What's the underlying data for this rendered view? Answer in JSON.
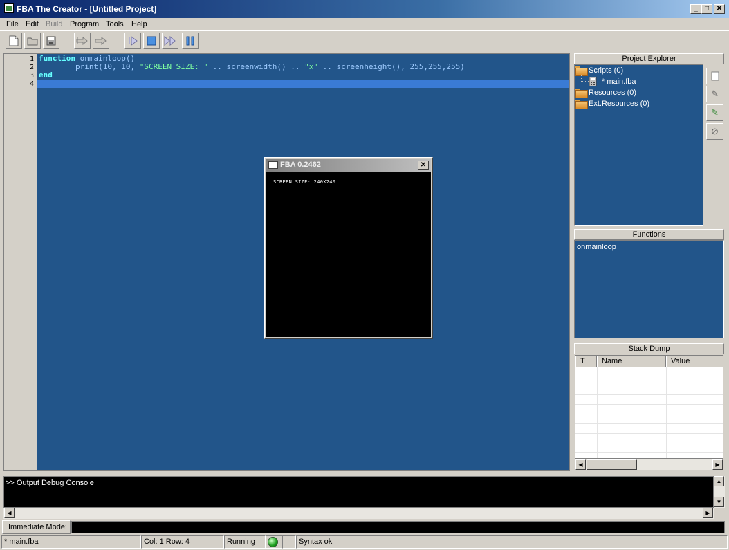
{
  "window": {
    "title": "FBA The Creator - [Untitled Project]",
    "controls": {
      "minimize": "_",
      "maximize": "□",
      "close": "✕"
    }
  },
  "menu": [
    "File",
    "Edit",
    "Build",
    "Program",
    "Tools",
    "Help"
  ],
  "menu_disabled": [
    "Build"
  ],
  "toolbar": {
    "buttons": [
      {
        "name": "new",
        "icon": "new-file-icon"
      },
      {
        "name": "open",
        "icon": "open-folder-icon"
      },
      {
        "name": "save",
        "icon": "save-disk-icon"
      },
      {
        "name": "step-into",
        "icon": "step-into-icon"
      },
      {
        "name": "step-over",
        "icon": "step-over-icon"
      },
      {
        "name": "run",
        "icon": "run-icon"
      },
      {
        "name": "stop",
        "icon": "stop-icon"
      },
      {
        "name": "fast-forward",
        "icon": "fast-forward-icon"
      },
      {
        "name": "pause",
        "icon": "pause-icon"
      }
    ]
  },
  "editor": {
    "line_numbers": [
      "1",
      "2",
      "3",
      "4"
    ],
    "lines": [
      {
        "kw": "function",
        "rest": " onmainloop()"
      },
      {
        "pre": "        print(10, 10, ",
        "str1": "\"SCREEN SIZE: \"",
        "mid": " .. screenwidth() .. ",
        "str2": "\"x\"",
        "post": " .. screenheight(), 255,255,255)"
      },
      {
        "kw": "end"
      },
      {
        "text": ""
      }
    ],
    "current_line": 4
  },
  "fba_window": {
    "title": "FBA 0.2462",
    "screen_text": "SCREEN SIZE: 240X240"
  },
  "project_explorer": {
    "header": "Project Explorer",
    "items": [
      {
        "label": "Scripts (0)",
        "type": "folder"
      },
      {
        "label": "* main.fba",
        "type": "file"
      },
      {
        "label": "Resources (0)",
        "type": "folder"
      },
      {
        "label": "Ext.Resources (0)",
        "type": "folder"
      }
    ]
  },
  "functions": {
    "header": "Functions",
    "items": [
      "onmainloop"
    ]
  },
  "stack_dump": {
    "header": "Stack Dump",
    "columns": [
      "T",
      "Name",
      "Value"
    ]
  },
  "console": {
    "text": ">> Output Debug Console"
  },
  "immediate": {
    "label": "Immediate Mode:",
    "value": ""
  },
  "status": {
    "file": "* main.fba",
    "position": "Col: 1 Row: 4",
    "state": "Running",
    "syntax": "Syntax ok",
    "indicator_color": "#20a020"
  }
}
